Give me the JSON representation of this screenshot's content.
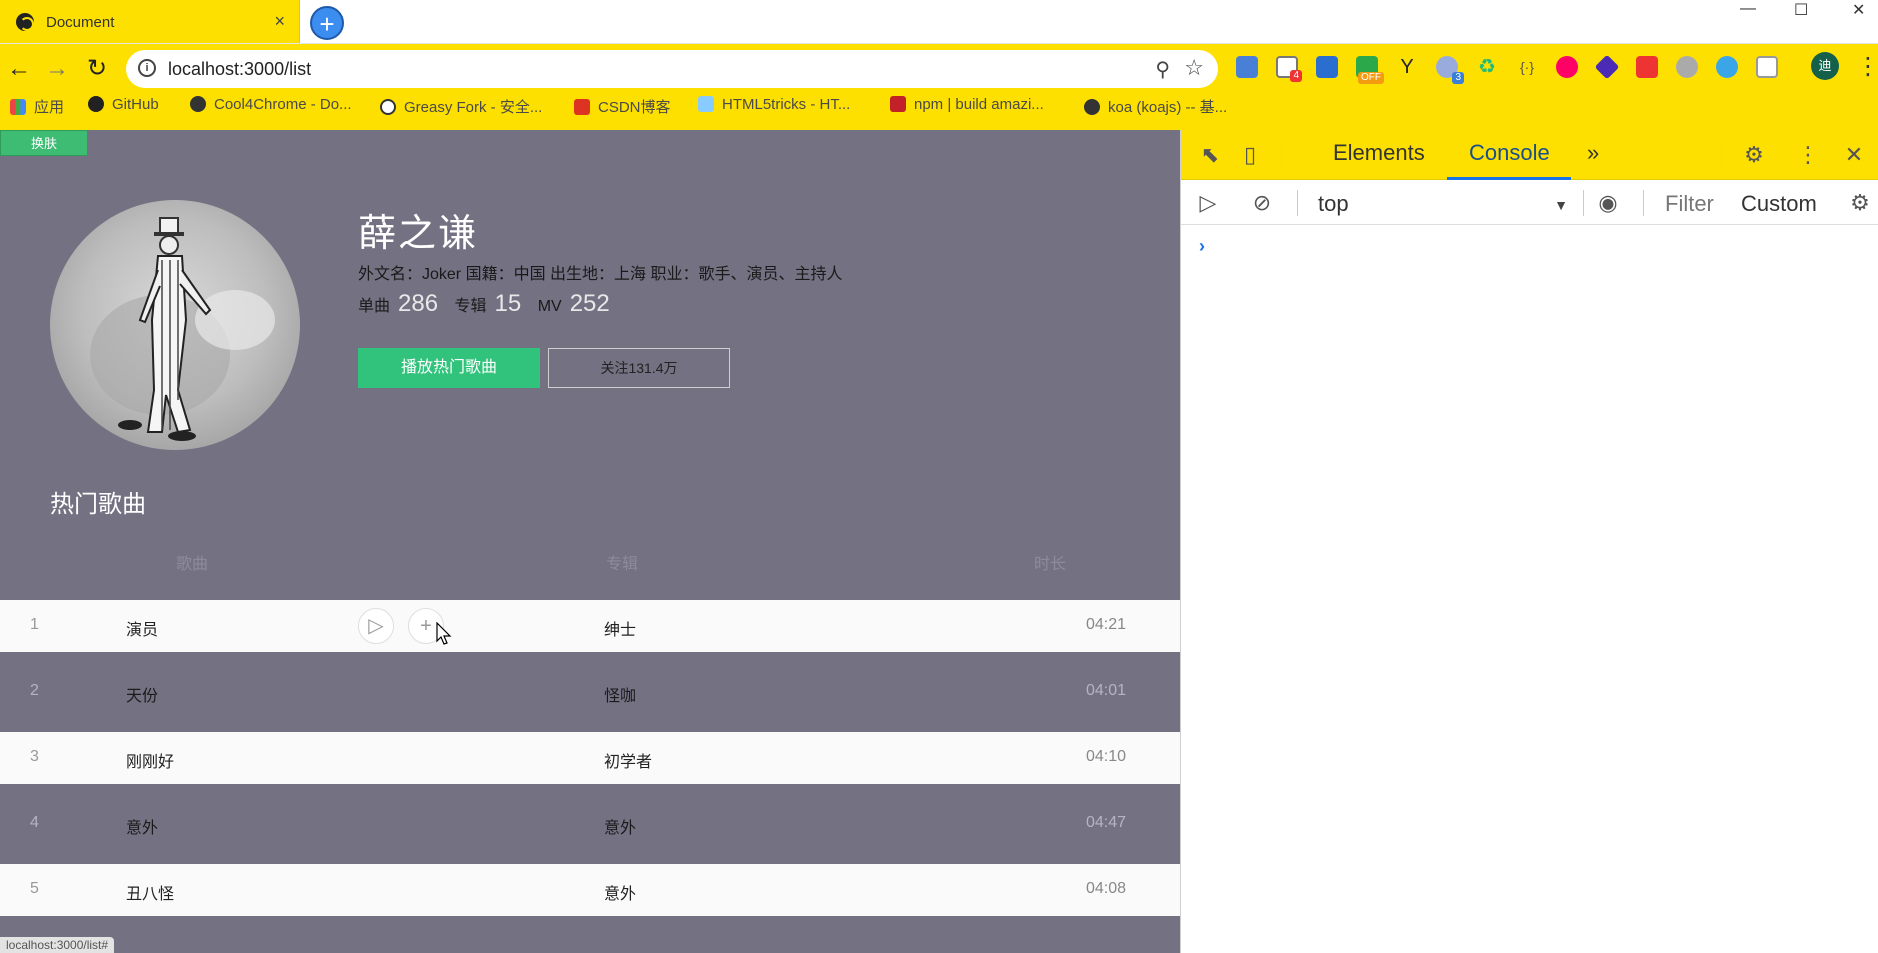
{
  "browser": {
    "tab_title": "Document",
    "tab_close": "×",
    "new_tab": "+",
    "url": "localhost:3000/list",
    "window_controls": [
      "—",
      "☐",
      "✕"
    ],
    "extension_badges": [
      "4",
      "OFF",
      "3"
    ],
    "profile_initial": "迪",
    "bookmarks": [
      "应用",
      "GitHub",
      "Cool4Chrome - Do...",
      "Greasy Fork - 安全...",
      "CSDN博客",
      "HTML5tricks - HT...",
      "npm | build amazi...",
      "koa (koajs) -- 基..."
    ]
  },
  "page": {
    "skin_button": "换肤",
    "artist": {
      "name": "薛之谦",
      "meta": "外文名：Joker 国籍：中国 出生地：上海 职业：歌手、演员、主持人",
      "stats": [
        {
          "label": "单曲",
          "value": "286"
        },
        {
          "label": "专辑",
          "value": "15"
        },
        {
          "label": "MV",
          "value": "252"
        }
      ]
    },
    "buttons": {
      "play_hot": "播放热门歌曲",
      "follow": "关注131.4万"
    },
    "section_title": "热门歌曲",
    "columns": {
      "song": "歌曲",
      "album": "专辑",
      "duration": "时长"
    },
    "songs": [
      {
        "index": "1",
        "name": "演员",
        "album": "绅士",
        "duration": "04:21"
      },
      {
        "index": "2",
        "name": "天份",
        "album": "怪咖",
        "duration": "04:01"
      },
      {
        "index": "3",
        "name": "刚刚好",
        "album": "初学者",
        "duration": "04:10"
      },
      {
        "index": "4",
        "name": "意外",
        "album": "意外",
        "duration": "04:47"
      },
      {
        "index": "5",
        "name": "丑八怪",
        "album": "意外",
        "duration": "04:08"
      }
    ],
    "row_ops": {
      "play": "▷",
      "add": "+"
    },
    "status_url": "localhost:3000/list#"
  },
  "devtools": {
    "tabs": [
      "Elements",
      "Console"
    ],
    "more": "»",
    "context": "top",
    "filter_placeholder": "Filter",
    "levels": "Custom",
    "prompt": "›"
  },
  "colors": {
    "chrome_yellow": "#fde000",
    "page_bg": "#747182",
    "accent_green": "#31c27c",
    "devtools_blue": "#1a73e8"
  }
}
